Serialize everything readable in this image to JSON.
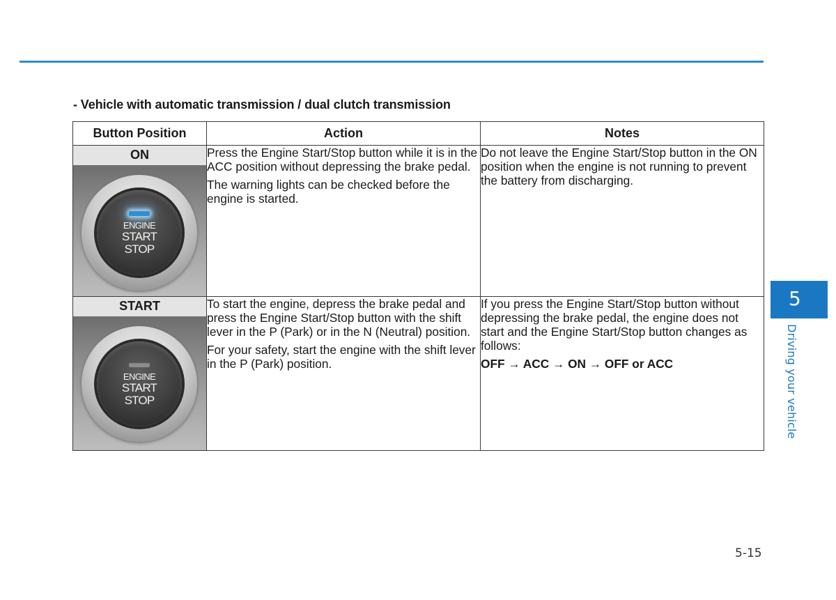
{
  "section_heading": "- Vehicle with automatic transmission / dual clutch transmission",
  "table": {
    "headers": [
      "Button Position",
      "Action",
      "Notes"
    ],
    "rows": [
      {
        "position": "ON",
        "button_label": {
          "line1": "ENGINE",
          "line2": "START",
          "line3": "STOP"
        },
        "indicator": "lit-blue",
        "action": [
          "Press the Engine Start/Stop button while it is in the ACC position without depressing the brake pedal.",
          "The warning lights can be checked before the engine is started."
        ],
        "notes": [
          "Do not leave the Engine Start/Stop button in the ON position when the engine is not running to prevent the battery from discharging."
        ]
      },
      {
        "position": "START",
        "button_label": {
          "line1": "ENGINE",
          "line2": "START",
          "line3": "STOP"
        },
        "indicator": "unlit",
        "action": [
          "To start the engine, depress the brake pedal and press the Engine Start/Stop button with the shift lever in the P (Park) or in the N (Neutral) position.",
          "For your safety, start the engine with the shift lever in the P (Park) position."
        ],
        "notes": [
          "If you press the Engine Start/Stop button without depressing the brake pedal, the engine does not start and the Engine Start/Stop button changes as follows:"
        ],
        "notes_sequence": "OFF → ACC → ON → OFF or ACC"
      }
    ]
  },
  "chapter_tab": {
    "number": "5",
    "title": "Driving your vehicle"
  },
  "page_number": "5-15",
  "colors": {
    "accent_blue": "#1a78c2",
    "rule_blue": "#2a8ccc"
  }
}
